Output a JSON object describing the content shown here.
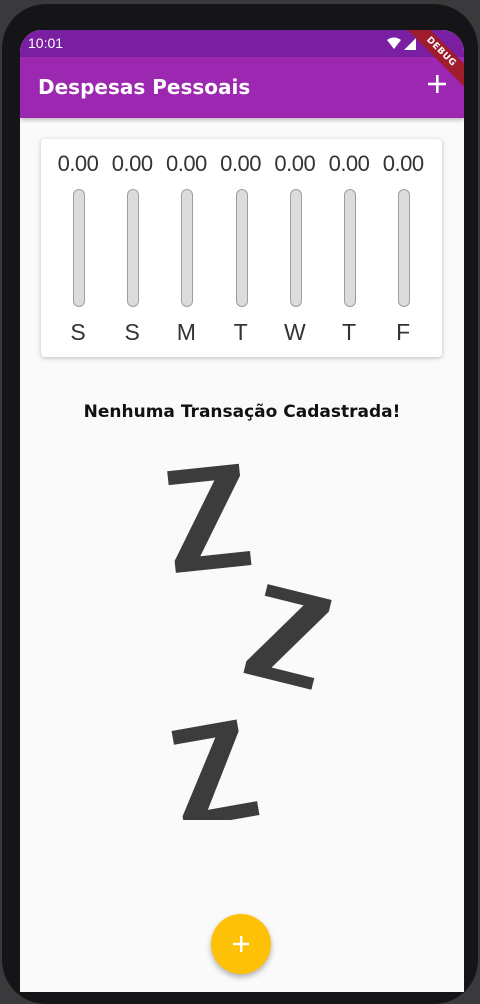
{
  "status_bar": {
    "time": "10:01"
  },
  "appbar": {
    "title": "Despesas Pessoais",
    "add_icon": "plus-icon"
  },
  "debug_banner": "DEBUG",
  "chart": {
    "bars": [
      {
        "day": "S",
        "value": "0.00",
        "fill": 0
      },
      {
        "day": "S",
        "value": "0.00",
        "fill": 0
      },
      {
        "day": "M",
        "value": "0.00",
        "fill": 0
      },
      {
        "day": "T",
        "value": "0.00",
        "fill": 0
      },
      {
        "day": "W",
        "value": "0.00",
        "fill": 0
      },
      {
        "day": "T",
        "value": "0.00",
        "fill": 0
      },
      {
        "day": "F",
        "value": "0.00",
        "fill": 0
      }
    ]
  },
  "empty_state": {
    "message": "Nenhuma Transação Cadastrada!",
    "image": "zzz-sleep-image"
  },
  "fab": {
    "icon": "plus-icon"
  },
  "colors": {
    "primary": "#9c27b0",
    "primary_dark": "#7b1fa2",
    "accent": "#ffc107"
  }
}
